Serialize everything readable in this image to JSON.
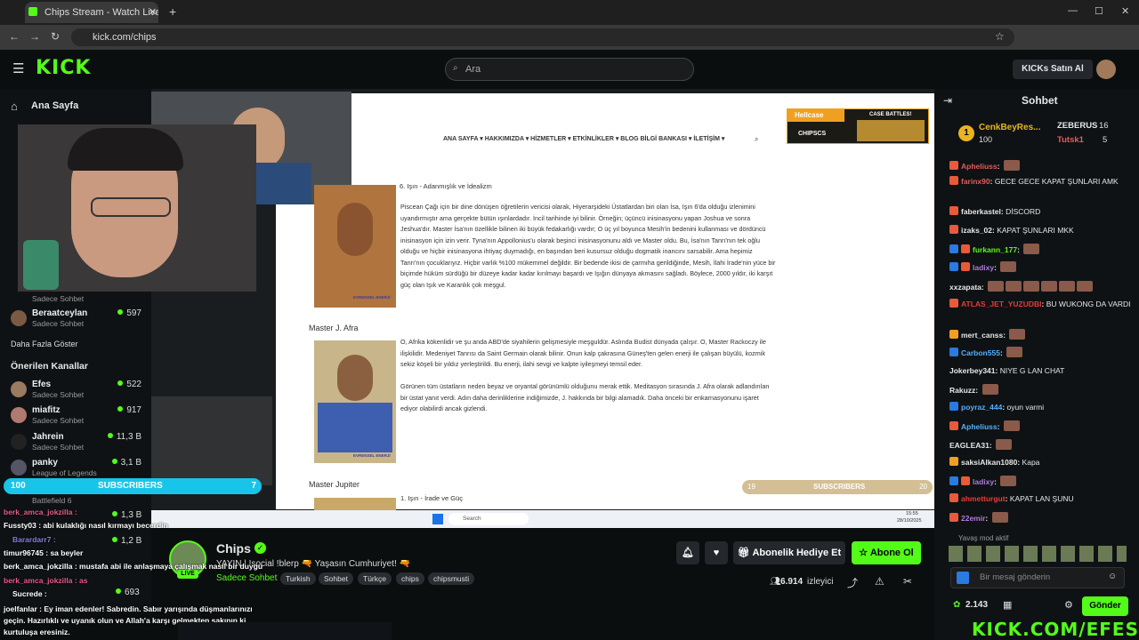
{
  "browser": {
    "tab_title": "Chips Stream - Watch Live on K",
    "url": "kick.com/chips"
  },
  "header": {
    "logo": "KICK",
    "search_placeholder": "Ara",
    "buy_kicks": "KICKs Satın Al"
  },
  "sidebar": {
    "home": "Ana Sayfa",
    "following_partial": [
      {
        "name": "Beraatceylan",
        "sub": "Sadece Sohbet",
        "count": "597"
      }
    ],
    "partial_sub_above": "Sadece Sohbet",
    "show_more": "Daha Fazla Göster",
    "recommended_title": "Önerilen Kanallar",
    "recommended": [
      {
        "name": "Efes",
        "sub": "Sadece Sohbet",
        "count": "522"
      },
      {
        "name": "miafitz",
        "sub": "Sadece Sohbet",
        "count": "917"
      },
      {
        "name": "Jahrein",
        "sub": "Sadece Sohbet",
        "count": "11,3 B"
      },
      {
        "name": "panky",
        "sub": "League of Legends",
        "count": "3,1 B"
      },
      {
        "name": "",
        "sub": "Battlefield 6",
        "count": "1,3 B"
      },
      {
        "name": "",
        "sub": "",
        "count": "1,2 B"
      },
      {
        "name": "",
        "sub": "",
        "count": "693"
      }
    ]
  },
  "stream": {
    "subscribers_left": {
      "count": "100",
      "label": "SUBSCRIBERS",
      "goal": "7"
    },
    "subscribers_right": {
      "count": "19",
      "label": "SUBSCRIBERS",
      "goal": "20"
    },
    "webpage_nav": "ANA SAYFA ▾   HAKKIMIZDA ▾   HİZMETLER ▾   ETKİNLİKLER ▾   BLOG   BİLGİ BANKASI ▾   İLETİŞİM ▾",
    "hellcase": "Hellcase",
    "hellcase_code": "CHIPSCS",
    "case_battles": "CASE BATTLES!",
    "section1_title": "6. Işın - Adanmışlık ve İdealizm",
    "section1_text": "Piscean Çağı için bir dine dönüşen öğretilerin vericisi olarak, Hiyerarşideki Üstatlardan biri olan İsa, Işın 6'da olduğu izlenimini uyandırmıştır ama gerçekte bütün ışınlardadır. İncil tarihinde iyi bilinir. Örneğin; üçüncü inisinasyonu yapan Joshua ve sonra Jeshua'dır. Master İsa'nın özellikle bilinen iki büyük fedakarlığı vardır; O üç yıl boyunca Mesih'in bedenini kullanması ve dördüncü inisinasyon için izin verir. Tyna'nın Appollonius'u olarak beşinci inisinasyonunu aldı ve Master oldu. Bu, İsa'nın Tanrı'nın tek oğlu olduğu ve hiçbir inisinasyona ihtiyaç duymadığı, en başından beri kusursuz olduğu dogmatik inancını sarsabilir. Ama hepimiz Tanrı'nın çocuklarıyız. Hiçbir varlık %100 mükemmel değildir. Bir bedende ikisi de çarmıha gerildiğinde, Mesih, İlahi İrade'nin yüce bir biçimde hüküm sürdüğü bir düzeye kadar kadar kırılmayı başardı ve Işığın dünyaya akmasını sağladı. Böylece, 2000 yıldır, iki karşıt güç olan Işık ve Karanlık çok meşgul.",
    "section2_title": "Master J. Afra",
    "section2_text1": "O, Afrika kökenlidir ve şu anda ABD'de siyahilerin gelişmesiyle meşguldür. Aslında Budist dünyada çalışır. O, Master Rackoczy ile ilişkilidir. Medeniyet Tanrısı da Saint Germain olarak bilinir. Onun kalp çakrasına Güneş'ten gelen enerji ile çalışan büyülü, kozmik sekiz köşeli bir yıldız yerleştirildi. Bu enerji, ilahi sevgi ve kalpte iyileşmeyi temsil eder.",
    "section2_text2": "Görünen tüm üstatların neden beyaz ve oryantal görünümlü olduğunu merak ettik. Meditasyon sırasında J. Afra olarak adlandırılan bir üstat yanıt verdi. Adın daha derinliklerine indiğimizde, J. hakkında bir bilgi alamadık. Daha önceki bir enkarnasyonunu işaret ediyor olabilirdi ancak gizlendi.",
    "section3_title": "Master Jupiter",
    "section3_sub": "1. Işın - İrade ve Güç",
    "painting_label": "EVRENSEL ENERJİ",
    "taskbar_search": "Search",
    "taskbar_time": "15:55",
    "taskbar_date": "28/10/2025"
  },
  "channel": {
    "name": "Chips",
    "live": "LIVE",
    "title": "YAYIN | !social !blerp 🔫 Yaşasın Cumhuriyet! 🔫",
    "category": "Sadece Sohbet",
    "tags": [
      "Turkish",
      "Sohbet",
      "Türkçe",
      "chips",
      "chipsmusti"
    ],
    "viewers": "6.914",
    "viewers_label": "izleyici",
    "gift_sub": "Abonelik Hediye Et",
    "subscribe": "Abone Ol"
  },
  "overlay_chat": [
    "berk_amca_jokzilla : ",
    "Fussty03 : abi kulaklığı nasıl kırmayı becerdin",
    "Barardarr7 : ",
    "timur96745 : sa beyler",
    "berk_amca_jokzilla : mustafa abi ile anlaşmaya çalışmak nasıl bir duygu",
    "berk_amca_jokzilla : as",
    "Sucrede : ",
    "joelfanlar : Ey iman edenler! Sabredin. Sabır yarışında düşmanlarınızı",
    "geçin. Hazırlıklı ve uyanık olun ve Allah'a karşı gelmekten sakının ki",
    "kurtuluşa eresiniz."
  ],
  "chat": {
    "title": "Sohbet",
    "leaderboard": [
      {
        "rank": "1",
        "name": "CenkBeyRes...",
        "score": "100"
      },
      {
        "name": "ZEBERUS",
        "score": "16"
      },
      {
        "name": "Tutsk1",
        "score": "5"
      }
    ],
    "messages": [
      {
        "user": "Apheliuss",
        "text": ""
      },
      {
        "user": "farinx90",
        "text": "GECE GECE KAPAT ŞUNLARI AMK"
      },
      {
        "user": "faberkastel",
        "text": "DİSCORD"
      },
      {
        "user": "izaks_02",
        "text": "KAPAT ŞUNLARI MKK"
      },
      {
        "user": "furkann_177",
        "text": ""
      },
      {
        "user": "ladixy",
        "text": ""
      },
      {
        "user": "xxzapata",
        "text": ""
      },
      {
        "user": "ATLAS_JET_YUZUDBI",
        "text": "BU WUKONG DA VARDI"
      },
      {
        "user": "mert_canss",
        "text": ""
      },
      {
        "user": "Carbon555",
        "text": ""
      },
      {
        "user": "Jokerbey341",
        "text": "NIYE G LAN CHAT"
      },
      {
        "user": "Rakuzz",
        "text": ""
      },
      {
        "user": "poyraz_444",
        "text": "oyun varmi"
      },
      {
        "user": "Apheliuss",
        "text": ""
      },
      {
        "user": "EAGLEA31",
        "text": ""
      },
      {
        "user": "saksiAlkan1080",
        "text": "Kapa"
      },
      {
        "user": "ladixy",
        "text": ""
      },
      {
        "user": "ahmetturgut",
        "text": "KAPAT LAN ŞUNU"
      },
      {
        "user": "22emir",
        "text": ""
      }
    ],
    "slow_mode": "Yavaş mod aktif",
    "input_placeholder": "Bir mesaj gönderin",
    "points": "2.143",
    "send": "Gönder"
  },
  "watermark": "KICK.COM/EFES",
  "colors": {
    "kick_green": "#53fc18",
    "sub_blue": "#18c5e8"
  }
}
